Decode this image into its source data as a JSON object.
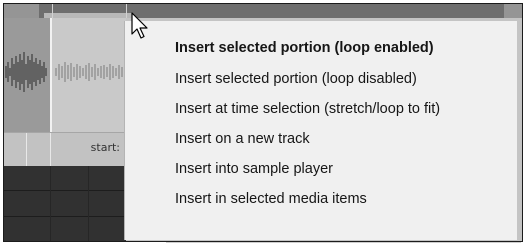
{
  "timeline": {
    "start_label": "start:"
  },
  "context_menu": {
    "items": [
      {
        "label": "Insert selected portion (loop enabled)",
        "bold": true
      },
      {
        "label": "Insert selected portion (loop disabled)",
        "bold": false
      },
      {
        "label": "Insert at time selection (stretch/loop to fit)",
        "bold": false
      },
      {
        "label": "Insert on a new track",
        "bold": false
      },
      {
        "label": "Insert into sample player",
        "bold": false
      },
      {
        "label": "Insert in selected media items",
        "bold": false
      }
    ]
  },
  "icons": {
    "cursor": "mouse-pointer-icon"
  }
}
